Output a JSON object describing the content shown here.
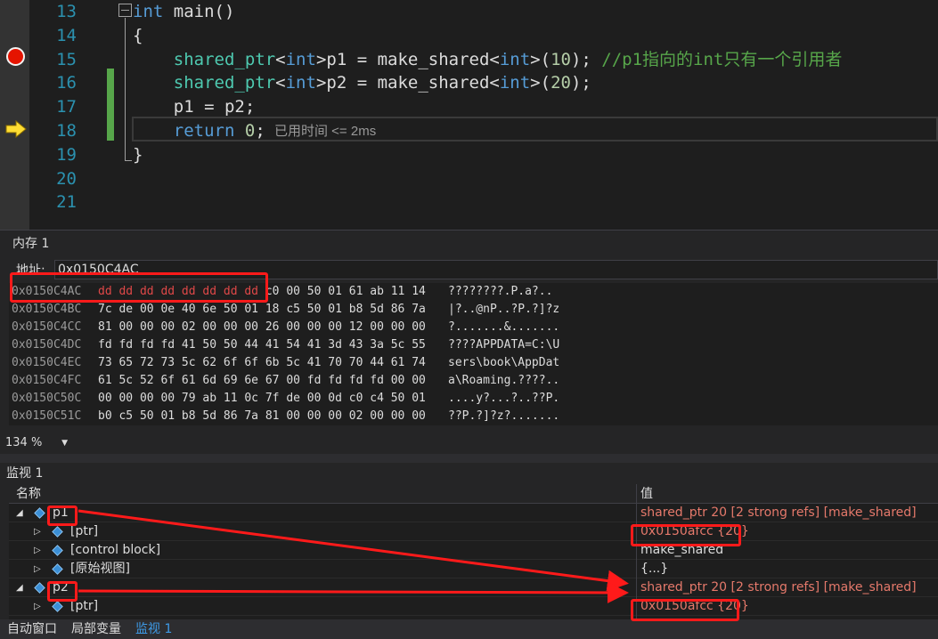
{
  "editor": {
    "lines": [
      {
        "n": "13",
        "parts": [
          [
            "kw",
            "int"
          ],
          [
            "pl",
            " main()"
          ]
        ]
      },
      {
        "n": "14",
        "parts": [
          [
            "pl",
            "{"
          ]
        ]
      },
      {
        "n": "15",
        "parts": [
          [
            "pl",
            "    "
          ],
          [
            "ty",
            "shared_ptr"
          ],
          [
            "pl",
            "<"
          ],
          [
            "kw",
            "int"
          ],
          [
            "pl",
            ">p1 = make_shared<"
          ],
          [
            "kw",
            "int"
          ],
          [
            "pl",
            ">("
          ],
          [
            "num",
            "10"
          ],
          [
            "pl",
            "); "
          ],
          [
            "cm",
            "//p1指向的int只有一个引用者"
          ]
        ]
      },
      {
        "n": "16",
        "parts": [
          [
            "pl",
            "    "
          ],
          [
            "ty",
            "shared_ptr"
          ],
          [
            "pl",
            "<"
          ],
          [
            "kw",
            "int"
          ],
          [
            "pl",
            ">p2 = make_shared<"
          ],
          [
            "kw",
            "int"
          ],
          [
            "pl",
            ">("
          ],
          [
            "num",
            "20"
          ],
          [
            "pl",
            ");"
          ]
        ]
      },
      {
        "n": "17",
        "parts": [
          [
            "pl",
            "    p1 = p2;"
          ]
        ]
      },
      {
        "n": "18",
        "parts": [
          [
            "pl",
            "    "
          ],
          [
            "kw",
            "return"
          ],
          [
            "pl",
            " "
          ],
          [
            "num",
            "0"
          ],
          [
            "pl",
            ";"
          ]
        ]
      },
      {
        "n": "19",
        "parts": [
          [
            "pl",
            "}"
          ]
        ]
      },
      {
        "n": "20",
        "parts": []
      },
      {
        "n": "21",
        "parts": []
      }
    ],
    "perf_tip": "已用时间 <= 2ms",
    "colors": {
      "keyword": "#569cd6",
      "type": "#4ec9b0",
      "number": "#b5cea8",
      "comment": "#57a64a",
      "breakpoint": "#e51400"
    }
  },
  "memory": {
    "title": "内存 1",
    "address_label": "地址:",
    "address_value": "0x0150C4AC",
    "rows": [
      {
        "addr": "0x0150C4AC",
        "changed": "dd dd dd dd dd dd dd dd",
        "hex": " c0 00 50 01 61 ab 11 14",
        "ascii": "????????.P.a?.."
      },
      {
        "addr": "0x0150C4BC",
        "changed": "",
        "hex": "7c de 00 0e 40 6e 50 01 18 c5 50 01 b8 5d 86 7a",
        "ascii": "|?..@nP..?P.?]?z"
      },
      {
        "addr": "0x0150C4CC",
        "changed": "",
        "hex": "81 00 00 00 02 00 00 00 26 00 00 00 12 00 00 00",
        "ascii": "?.......&......."
      },
      {
        "addr": "0x0150C4DC",
        "changed": "",
        "hex": "fd fd fd fd 41 50 50 44 41 54 41 3d 43 3a 5c 55",
        "ascii": "????APPDATA=C:\\U"
      },
      {
        "addr": "0x0150C4EC",
        "changed": "",
        "hex": "73 65 72 73 5c 62 6f 6f 6b 5c 41 70 70 44 61 74",
        "ascii": "sers\\book\\AppDat"
      },
      {
        "addr": "0x0150C4FC",
        "changed": "",
        "hex": "61 5c 52 6f 61 6d 69 6e 67 00 fd fd fd fd 00 00",
        "ascii": "a\\Roaming.????.."
      },
      {
        "addr": "0x0150C50C",
        "changed": "",
        "hex": "00 00 00 00 79 ab 11 0c 7f de 00 0d c0 c4 50 01",
        "ascii": "....y?...?..??P."
      },
      {
        "addr": "0x0150C51C",
        "changed": "",
        "hex": "b0 c5 50 01 b8 5d 86 7a 81 00 00 00 02 00 00 00",
        "ascii": "??P.?]?z?......."
      }
    ],
    "zoom": "134 %"
  },
  "watch": {
    "title": "监视 1",
    "col_name": "名称",
    "col_value": "值",
    "rows": [
      {
        "expander": "◢",
        "indent": 0,
        "name": "p1",
        "value": "shared_ptr 20 [2 strong refs] [make_shared]",
        "style": "val-red"
      },
      {
        "expander": "▷",
        "indent": 1,
        "name": "[ptr]",
        "value": "0x0150afcc {20}",
        "style": "val-red"
      },
      {
        "expander": "▷",
        "indent": 1,
        "name": "[control block]",
        "value": "make_shared",
        "style": "val-plain"
      },
      {
        "expander": "▷",
        "indent": 1,
        "name": "[原始视图]",
        "value": "{...}",
        "style": "val-plain"
      },
      {
        "expander": "◢",
        "indent": 0,
        "name": "p2",
        "value": "shared_ptr 20 [2 strong refs] [make_shared]",
        "style": "val-red"
      },
      {
        "expander": "▷",
        "indent": 1,
        "name": "[ptr]",
        "value": "0x0150afcc {20}",
        "style": "val-red"
      }
    ]
  },
  "tabs": [
    {
      "label": "自动窗口",
      "active": false
    },
    {
      "label": "局部变量",
      "active": false
    },
    {
      "label": "监视 1",
      "active": true
    }
  ],
  "annotation_color": "#ff1a1a"
}
